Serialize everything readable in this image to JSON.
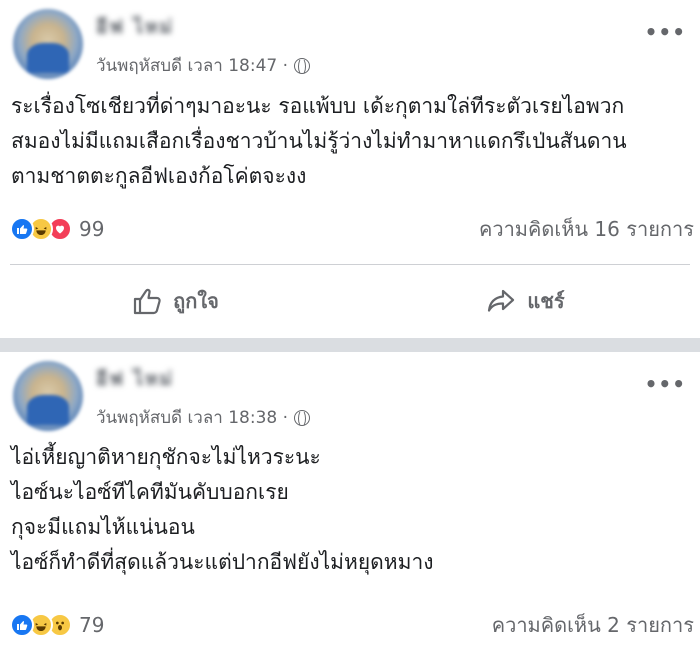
{
  "posts": [
    {
      "author": "อีฟ ไหม่",
      "timestamp": "วันพฤหัสบดี เวลา 18:47 ·",
      "more": "•••",
      "lines": [
        "ระเรื่องโซเชียวที่ด่าๆมาอะนะ รอแพ้บบ เด้ะกุตามใล่ทีระตัวเรยไอพวก",
        "สมองไม่มีแถมเสือกเรื่องชาวบ้านไม่รู้ว่างไม่ทำมาหาแดกรึเป่นสันดาน",
        "ตามชาตตะกูลอีฟเองก้อโค่ตจะงง"
      ],
      "reactions": [
        "like",
        "haha",
        "love"
      ],
      "reaction_count": "99",
      "comments": "ความคิดเห็น 16 รายการ",
      "actions": {
        "like": "ถูกใจ",
        "share": "แชร์"
      }
    },
    {
      "author": "อีฟ ไหม่",
      "timestamp": "วันพฤหัสบดี เวลา 18:38 ·",
      "more": "•••",
      "lines": [
        "ไอ่เหี้ยญาติหายกุชักจะไม่ไหวระนะ",
        "ไอซ์นะไอซ์ทีไคทีมันคับบอกเรย",
        "กุจะมีแถมไห้แน่นอน",
        "ไอซ์ก็ทำดีที่สุดแล้วนะแต่ปากอีฟยังไม่หยุดหมาง"
      ],
      "reactions": [
        "like",
        "haha",
        "wow"
      ],
      "reaction_count": "79",
      "comments": "ความคิดเห็น 2 รายการ"
    }
  ],
  "colors": {
    "accent": "#1877f2",
    "secondary_text": "#65676b",
    "separator": "#dadde1"
  }
}
